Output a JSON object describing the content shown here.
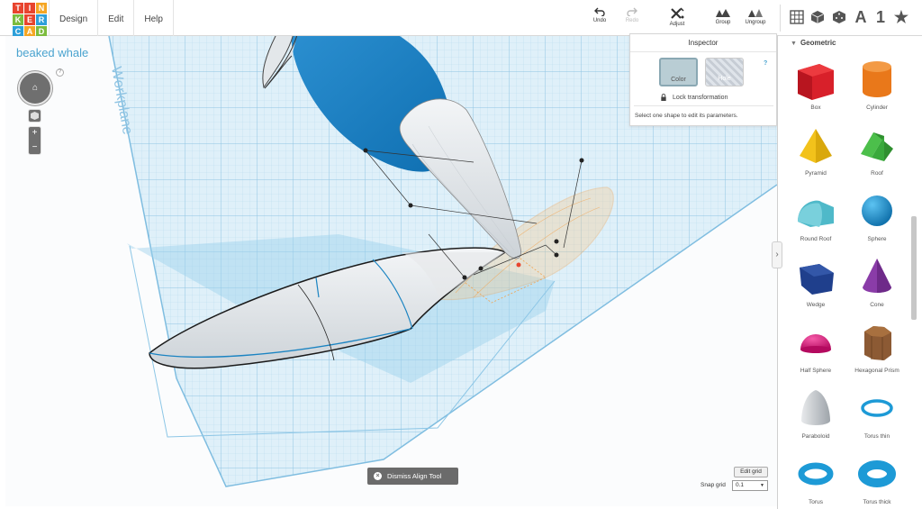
{
  "app": {
    "logo_letters": [
      "T",
      "I",
      "N",
      "K",
      "E",
      "R",
      "C",
      "A",
      "D"
    ],
    "logo_colors": [
      "#e8442e",
      "#e8442e",
      "#f5a623",
      "#7cbc3e",
      "#e8442e",
      "#2d9fd9",
      "#2d9fd9",
      "#f5a623",
      "#7cbc3e"
    ],
    "menu": [
      "Design",
      "Edit",
      "Help"
    ]
  },
  "toolbar": {
    "undo": "Undo",
    "redo": "Redo",
    "adjust": "Adjust",
    "group": "Group",
    "ungroup": "Ungroup",
    "view_text": "A",
    "view_number": "1",
    "view_star": "★"
  },
  "project": {
    "title": "beaked whale",
    "help": "?",
    "workplane_label": "Workplane"
  },
  "inspector": {
    "title": "Inspector",
    "color_label": "Color",
    "hole_label": "Hole",
    "help": "?",
    "lock_label": "Lock transformation",
    "hint": "Select one shape to edit its parameters."
  },
  "panel": {
    "section": "Geometric",
    "shapes": [
      {
        "label": "Box",
        "icon": "box-icon",
        "color": "#d8202a"
      },
      {
        "label": "Cylinder",
        "icon": "cylinder-icon",
        "color": "#e9781a"
      },
      {
        "label": "Pyramid",
        "icon": "pyramid-icon",
        "color": "#f2c21b"
      },
      {
        "label": "Roof",
        "icon": "roof-icon",
        "color": "#39a93b"
      },
      {
        "label": "Round Roof",
        "icon": "round-roof-icon",
        "color": "#4fb9c9"
      },
      {
        "label": "Sphere",
        "icon": "sphere-icon",
        "color": "#1d9ad6"
      },
      {
        "label": "Wedge",
        "icon": "wedge-icon",
        "color": "#1f3f8c"
      },
      {
        "label": "Cone",
        "icon": "cone-icon",
        "color": "#8a3ca8"
      },
      {
        "label": "Half Sphere",
        "icon": "half-sphere-icon",
        "color": "#e0177f"
      },
      {
        "label": "Hexagonal Prism",
        "icon": "hexagonal-prism-icon",
        "color": "#8c5a34"
      },
      {
        "label": "Paraboloid",
        "icon": "paraboloid-icon",
        "color": "#c9cdd1"
      },
      {
        "label": "Torus thin",
        "icon": "torus-thin-icon",
        "color": "#1d9ad6"
      },
      {
        "label": "Torus",
        "icon": "torus-icon",
        "color": "#1d9ad6"
      },
      {
        "label": "Torus thick",
        "icon": "torus-thick-icon",
        "color": "#1d9ad6"
      }
    ]
  },
  "bottom": {
    "dismiss": "Dismiss Align Tool",
    "edit_grid": "Edit grid",
    "snap_label": "Snap grid",
    "snap_value": "0.1"
  }
}
